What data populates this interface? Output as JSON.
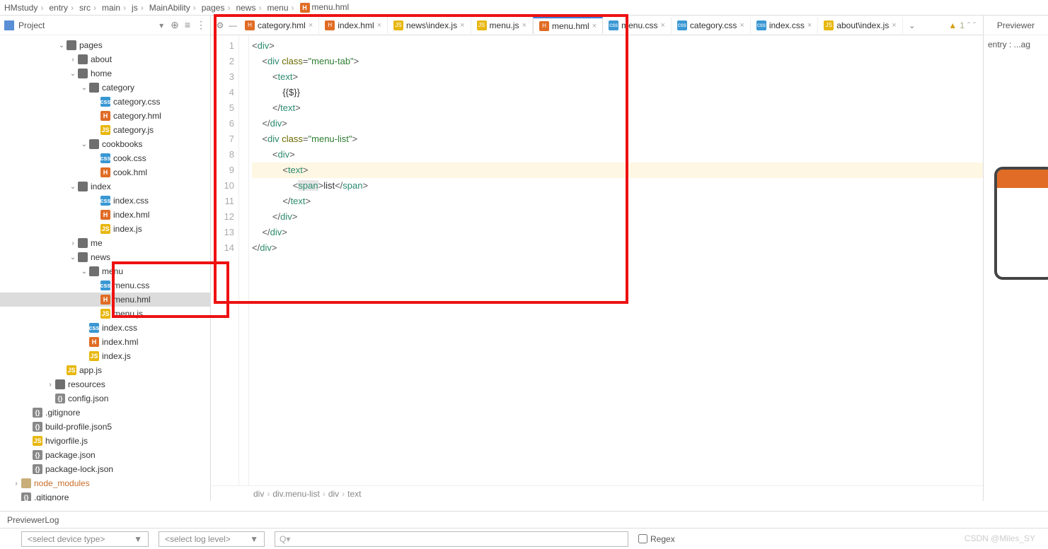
{
  "breadcrumb": [
    "HMstudy",
    "entry",
    "src",
    "main",
    "js",
    "MainAbility",
    "pages",
    "news",
    "menu",
    "menu.hml"
  ],
  "project_label": "Project",
  "tree": [
    {
      "d": 5,
      "a": "v",
      "i": "fdg",
      "t": "pages"
    },
    {
      "d": 6,
      "a": ">",
      "i": "fdg",
      "t": "about"
    },
    {
      "d": 6,
      "a": "v",
      "i": "fdg",
      "t": "home"
    },
    {
      "d": 7,
      "a": "v",
      "i": "fdg",
      "t": "category"
    },
    {
      "d": 8,
      "a": "",
      "i": "css",
      "t": "category.css"
    },
    {
      "d": 8,
      "a": "",
      "i": "hml",
      "t": "category.hml"
    },
    {
      "d": 8,
      "a": "",
      "i": "js",
      "t": "category.js"
    },
    {
      "d": 7,
      "a": "v",
      "i": "fdg",
      "t": "cookbooks"
    },
    {
      "d": 8,
      "a": "",
      "i": "css",
      "t": "cook.css"
    },
    {
      "d": 8,
      "a": "",
      "i": "hml",
      "t": "cook.hml"
    },
    {
      "d": 6,
      "a": "v",
      "i": "fdg",
      "t": "index"
    },
    {
      "d": 8,
      "a": "",
      "i": "css",
      "t": "index.css"
    },
    {
      "d": 8,
      "a": "",
      "i": "hml",
      "t": "index.hml"
    },
    {
      "d": 8,
      "a": "",
      "i": "js",
      "t": "index.js"
    },
    {
      "d": 6,
      "a": ">",
      "i": "fdg",
      "t": "me"
    },
    {
      "d": 6,
      "a": "v",
      "i": "fdg",
      "t": "news"
    },
    {
      "d": 7,
      "a": "v",
      "i": "fdg",
      "t": "menu"
    },
    {
      "d": 8,
      "a": "",
      "i": "css",
      "t": "menu.css"
    },
    {
      "d": 8,
      "a": "",
      "i": "hml",
      "t": "menu.hml",
      "sel": true
    },
    {
      "d": 8,
      "a": "",
      "i": "js",
      "t": "menu.js"
    },
    {
      "d": 7,
      "a": "",
      "i": "css",
      "t": "index.css"
    },
    {
      "d": 7,
      "a": "",
      "i": "hml",
      "t": "index.hml"
    },
    {
      "d": 7,
      "a": "",
      "i": "js",
      "t": "index.js"
    },
    {
      "d": 5,
      "a": "",
      "i": "js",
      "t": "app.js"
    },
    {
      "d": 4,
      "a": ">",
      "i": "fdg",
      "t": "resources"
    },
    {
      "d": 4,
      "a": "",
      "i": "json",
      "t": "config.json"
    },
    {
      "d": 2,
      "a": "",
      "i": "json",
      "t": ".gitignore"
    },
    {
      "d": 2,
      "a": "",
      "i": "json",
      "t": "build-profile.json5"
    },
    {
      "d": 2,
      "a": "",
      "i": "js",
      "t": "hvigorfile.js"
    },
    {
      "d": 2,
      "a": "",
      "i": "json",
      "t": "package.json"
    },
    {
      "d": 2,
      "a": "",
      "i": "json",
      "t": "package-lock.json"
    },
    {
      "d": 1,
      "a": ">",
      "i": "fd",
      "t": "node_modules",
      "cls": "nm"
    },
    {
      "d": 1,
      "a": "",
      "i": "json",
      "t": ".gitignore"
    }
  ],
  "tabs": [
    {
      "i": "hml",
      "t": "category.hml"
    },
    {
      "i": "hml",
      "t": "index.hml"
    },
    {
      "i": "js",
      "t": "news\\index.js"
    },
    {
      "i": "js",
      "t": "menu.js"
    },
    {
      "i": "hml",
      "t": "menu.hml",
      "active": true
    },
    {
      "i": "css",
      "t": "menu.css"
    },
    {
      "i": "css",
      "t": "category.css"
    },
    {
      "i": "css",
      "t": "index.css"
    },
    {
      "i": "js",
      "t": "about\\index.js"
    }
  ],
  "warn_count": "1",
  "code_lines": 14,
  "code_html": [
    "<span class='t-punc'>&lt;</span><span class='t-tag'>div</span><span class='t-punc'>&gt;</span>",
    "    <span class='t-punc'>&lt;</span><span class='t-tag'>div</span> <span class='t-attr'>class</span><span class='t-punc'>=</span><span class='t-str'>\"menu-tab\"</span><span class='t-punc'>&gt;</span>",
    "        <span class='t-punc'>&lt;</span><span class='t-tag'>text</span><span class='t-punc'>&gt;</span>",
    "            <span class='t-txt'>{{$}}</span>",
    "        <span class='t-punc'>&lt;/</span><span class='t-tag'>text</span><span class='t-punc'>&gt;</span>",
    "    <span class='t-punc'>&lt;/</span><span class='t-tag'>div</span><span class='t-punc'>&gt;</span>",
    "    <span class='t-punc'>&lt;</span><span class='t-tag'>div</span> <span class='t-attr'>class</span><span class='t-punc'>=</span><span class='t-str'>\"menu-list\"</span><span class='t-punc'>&gt;</span>",
    "        <span class='t-punc'>&lt;</span><span class='t-tag'>div</span><span class='t-punc'>&gt;</span>",
    "            <span class='t-punc'>&lt;</span><span class='t-tag'>text</span><span class='t-punc'>&gt;</span>",
    "                <span class='t-punc'>&lt;</span><span class='t-tag bg-span'>span</span><span class='t-punc'>&gt;</span><span class='t-txt'>list</span><span class='t-punc'>&lt;/</span><span class='t-tag'>span</span><span class='t-punc'>&gt;</span>",
    "            <span class='t-punc'>&lt;/</span><span class='t-tag'>text</span><span class='t-punc'>&gt;</span>",
    "        <span class='t-punc'>&lt;/</span><span class='t-tag'>div</span><span class='t-punc'>&gt;</span>",
    "    <span class='t-punc'>&lt;/</span><span class='t-tag'>div</span><span class='t-punc'>&gt;</span>",
    "<span class='t-punc'>&lt;/</span><span class='t-tag'>div</span><span class='t-punc'>&gt;</span>"
  ],
  "caret_line": 9,
  "editor_bcrumb": [
    "div",
    "div.menu-list",
    "div",
    "text"
  ],
  "previewer_label": "Previewer",
  "previewer_entry": "entry : ...ag",
  "log_title": "PreviewerLog",
  "dd_device": "<select device type>",
  "dd_level": "<select log level>",
  "search_placeholder": "Q▾",
  "regex_label": "Regex",
  "watermark": "CSDN @Miles_SY"
}
